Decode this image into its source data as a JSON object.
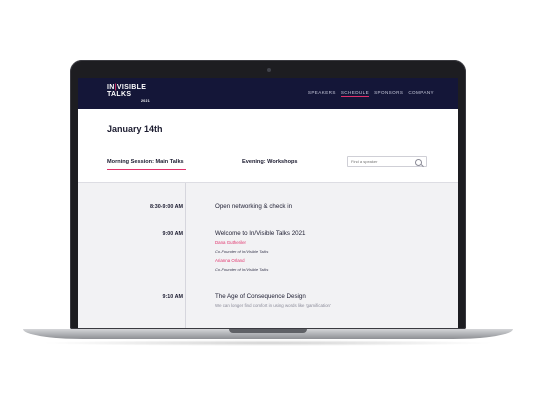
{
  "header": {
    "logo_line1_a": "IN",
    "logo_pipe": "|",
    "logo_line1_b": "VISIBLE",
    "logo_line2": "TALKS",
    "logo_year": "2021",
    "nav": [
      "SPEAKERS",
      "SCHEDULE",
      "SPONSORS",
      "COMPANY"
    ],
    "active_nav": "SCHEDULE"
  },
  "page": {
    "title": "January 14th"
  },
  "tabs": {
    "main": "Morning Session: Main Talks",
    "evening": "Evening: Workshops",
    "active": "Morning Session: Main Talks"
  },
  "search": {
    "placeholder": "Find a speaker"
  },
  "schedule": [
    {
      "time": "8:30-9:00 AM",
      "title": "Open networking & check in"
    },
    {
      "time": "9:00 AM",
      "title": "Welcome to In/Visible Talks 2021",
      "speakers": [
        {
          "name": "Dana Gutheriler",
          "role": "Co-Founder of In/Visible Talks"
        },
        {
          "name": "Arianna Orland",
          "role": "Co-Founder of In/Visible Talks"
        }
      ]
    },
    {
      "time": "9:10 AM",
      "title": "The Age of Consequence Design",
      "description": "We can longer find comfort in using words like 'gamification'"
    }
  ],
  "colors": {
    "header_bg": "#141638",
    "accent": "#e0316b",
    "schedule_bg": "#f2f2f4"
  }
}
